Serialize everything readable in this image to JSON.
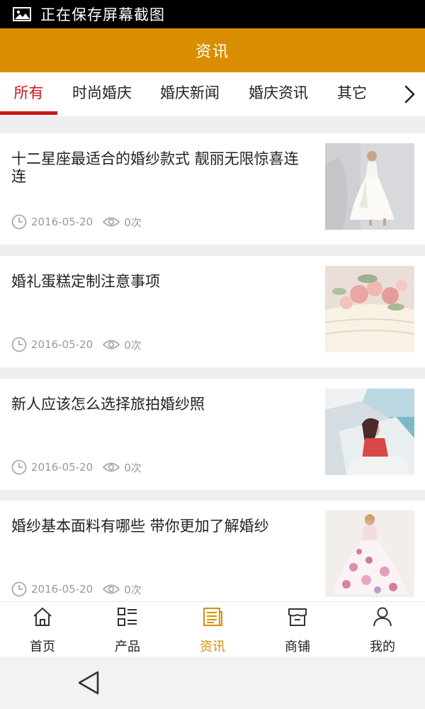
{
  "status_bar": {
    "text": "正在保存屏幕截图"
  },
  "header": {
    "title": "资讯"
  },
  "tabs": [
    {
      "label": "所有",
      "active": true
    },
    {
      "label": "时尚婚庆",
      "active": false
    },
    {
      "label": "婚庆新闻",
      "active": false
    },
    {
      "label": "婚庆资讯",
      "active": false
    },
    {
      "label": "其它",
      "active": false
    }
  ],
  "articles": [
    {
      "title": "十二星座最适合的婚纱款式 靓丽无限惊喜连连",
      "date": "2016-05-20",
      "views": "0次",
      "thumb": "bride-white-dress"
    },
    {
      "title": "婚礼蛋糕定制注意事项",
      "date": "2016-05-20",
      "views": "0次",
      "thumb": "wedding-cake-roses"
    },
    {
      "title": "新人应该怎么选择旅拍婚纱照",
      "date": "2016-05-20",
      "views": "0次",
      "thumb": "couple-car-seaside"
    },
    {
      "title": "婚纱基本面料有哪些 带你更加了解婚纱",
      "date": "2016-05-20",
      "views": "0次",
      "thumb": "floral-ball-gown"
    }
  ],
  "bottom_nav": [
    {
      "label": "首页",
      "icon": "home-icon",
      "active": false
    },
    {
      "label": "产品",
      "icon": "product-list-icon",
      "active": false
    },
    {
      "label": "资讯",
      "icon": "news-icon",
      "active": true
    },
    {
      "label": "商铺",
      "icon": "store-icon",
      "active": false
    },
    {
      "label": "我的",
      "icon": "user-icon",
      "active": false
    }
  ],
  "colors": {
    "brand": "#d98e00",
    "active_tab": "#c8161d",
    "meta": "#9a9a9a"
  }
}
